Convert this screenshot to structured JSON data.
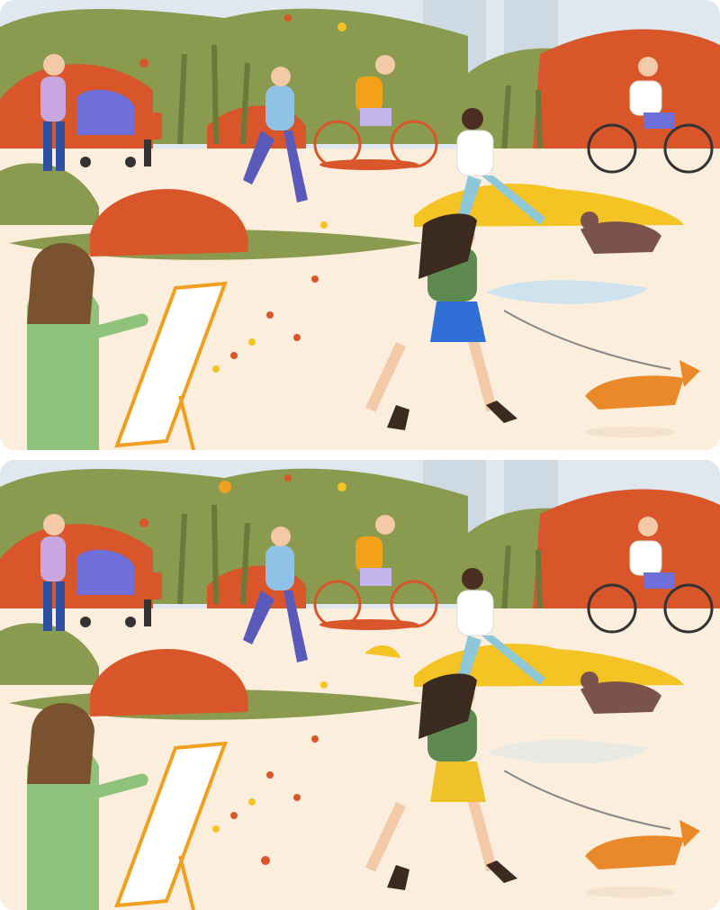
{
  "image": {
    "kind": "spot-the-difference illustration",
    "panels": [
      "top",
      "bottom"
    ]
  },
  "colors": {
    "sky": "#dfe8ee",
    "path": "#fbeedd",
    "green": "#8a9a4f",
    "dark_green": "#6b7a3a",
    "orange": "#d9562a",
    "yellow": "#f4c324",
    "skirt_top": "#2f6fd6",
    "skirt_bottom": "#f0c22a",
    "dog": "#e9892a",
    "brown_dog": "#7a544b",
    "lilac": "#b7a6e6"
  }
}
